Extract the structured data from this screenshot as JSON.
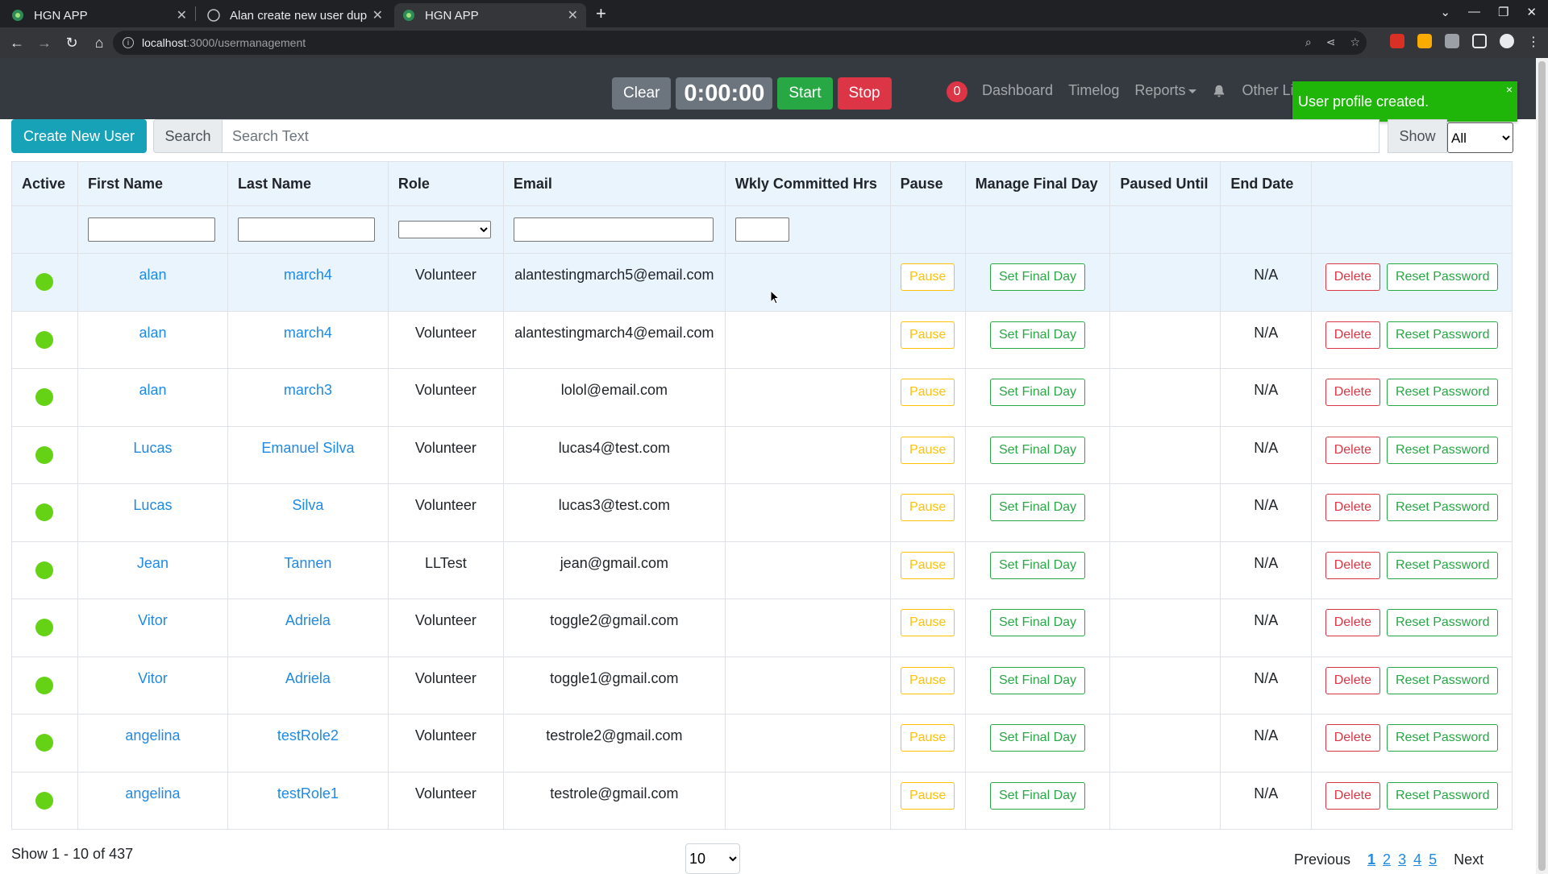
{
  "browser": {
    "tabs": [
      {
        "title": "HGN APP",
        "active": false
      },
      {
        "title": "Alan create new user duplicate",
        "active": false
      },
      {
        "title": "HGN APP",
        "active": true
      }
    ],
    "url_host": "localhost",
    "url_path": ":3000/usermanagement"
  },
  "timer": {
    "clear_label": "Clear",
    "time": "0:00:00",
    "start_label": "Start",
    "stop_label": "Stop"
  },
  "nav": {
    "notification_count": "0",
    "links": [
      "Dashboard",
      "Timelog",
      "Reports",
      "Other Li"
    ]
  },
  "toast": {
    "message": "User profile created.",
    "close": "×"
  },
  "toolbar": {
    "create_label": "Create New User",
    "search_label": "Search",
    "search_placeholder": "Search Text",
    "show_label": "Show",
    "show_value": "All"
  },
  "table": {
    "headers": [
      "Active",
      "First Name",
      "Last Name",
      "Role",
      "Email",
      "Wkly Committed Hrs",
      "Pause",
      "Manage Final Day",
      "Paused Until",
      "End Date",
      ""
    ],
    "pause_label": "Pause",
    "final_label": "Set Final Day",
    "delete_label": "Delete",
    "reset_label": "Reset Password",
    "rows": [
      {
        "first": "alan",
        "last": "march4",
        "role": "Volunteer",
        "email": "alantestingmarch5@email.com",
        "end": "N/A"
      },
      {
        "first": "alan",
        "last": "march4",
        "role": "Volunteer",
        "email": "alantestingmarch4@email.com",
        "end": "N/A"
      },
      {
        "first": "alan",
        "last": "march3",
        "role": "Volunteer",
        "email": "lolol@email.com",
        "end": "N/A"
      },
      {
        "first": "Lucas",
        "last": "Emanuel Silva",
        "role": "Volunteer",
        "email": "lucas4@test.com",
        "end": "N/A"
      },
      {
        "first": "Lucas",
        "last": "Silva",
        "role": "Volunteer",
        "email": "lucas3@test.com",
        "end": "N/A"
      },
      {
        "first": "Jean",
        "last": "Tannen",
        "role": "LLTest",
        "email": "jean@gmail.com",
        "end": "N/A"
      },
      {
        "first": "Vitor",
        "last": "Adriela",
        "role": "Volunteer",
        "email": "toggle2@gmail.com",
        "end": "N/A"
      },
      {
        "first": "Vitor",
        "last": "Adriela",
        "role": "Volunteer",
        "email": "toggle1@gmail.com",
        "end": "N/A"
      },
      {
        "first": "angelina",
        "last": "testRole2",
        "role": "Volunteer",
        "email": "testrole2@gmail.com",
        "end": "N/A"
      },
      {
        "first": "angelina",
        "last": "testRole1",
        "role": "Volunteer",
        "email": "testrole@gmail.com",
        "end": "N/A"
      }
    ]
  },
  "footer": {
    "show_count": "Show 1 - 10 of 437",
    "page_size": "10",
    "previous": "Previous",
    "pages": [
      "1",
      "2",
      "3",
      "4",
      "5"
    ],
    "next": "Next"
  },
  "colors": {
    "active_dot": "#66d216",
    "toast_bg": "#1fb609",
    "navbar_bg": "#343a40"
  }
}
